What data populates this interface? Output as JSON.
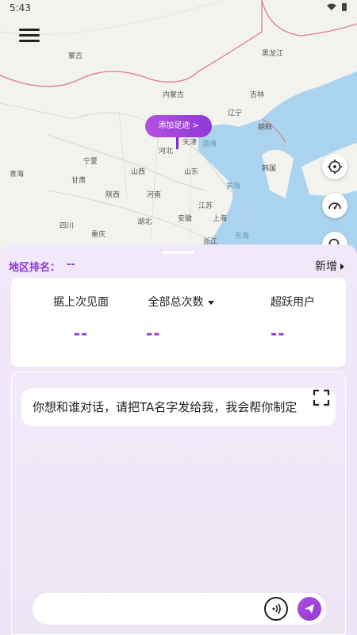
{
  "status_bar": {
    "time": "5:43"
  },
  "map": {
    "labels": {
      "mongolia": "蒙古",
      "heilongjiang": "黑龙江",
      "inner_mongolia": "内蒙古",
      "jilin": "吉林",
      "liaoning": "辽宁",
      "tianjin": "天津",
      "hebei": "河北",
      "bohai": "渤海",
      "chaoxian": "朝鲜",
      "qinghai": "青海",
      "ningxia": "宁夏",
      "gansu": "甘肃",
      "shanxi": "山西",
      "shandong": "山东",
      "hanguo": "韩国",
      "shaanxi": "陕西",
      "henan": "河南",
      "jiangsu": "江苏",
      "huanghai": "黄海",
      "sichuan": "四川",
      "hubei": "湖北",
      "anhui": "安徽",
      "shanghai": "上海",
      "chongqing": "重庆",
      "donghai": "东海",
      "zhejiang": "浙江"
    },
    "add_footprint_label": "添加足迹 >"
  },
  "sheet": {
    "rank_label": "地区排名：",
    "rank_value": "--",
    "new_add_label": "新增",
    "stats": [
      {
        "label": "据上次见面",
        "value": "--"
      },
      {
        "label": "全部总次数",
        "value": "--"
      },
      {
        "label": "超跃用户",
        "value": "--"
      }
    ],
    "chat": {
      "message": "你想和谁对话，请把TA名字发给我，我会帮你制定",
      "input_placeholder": ""
    }
  },
  "colors": {
    "accent": "#8e3ad6",
    "sheet_bg": "#f1e8fa"
  }
}
